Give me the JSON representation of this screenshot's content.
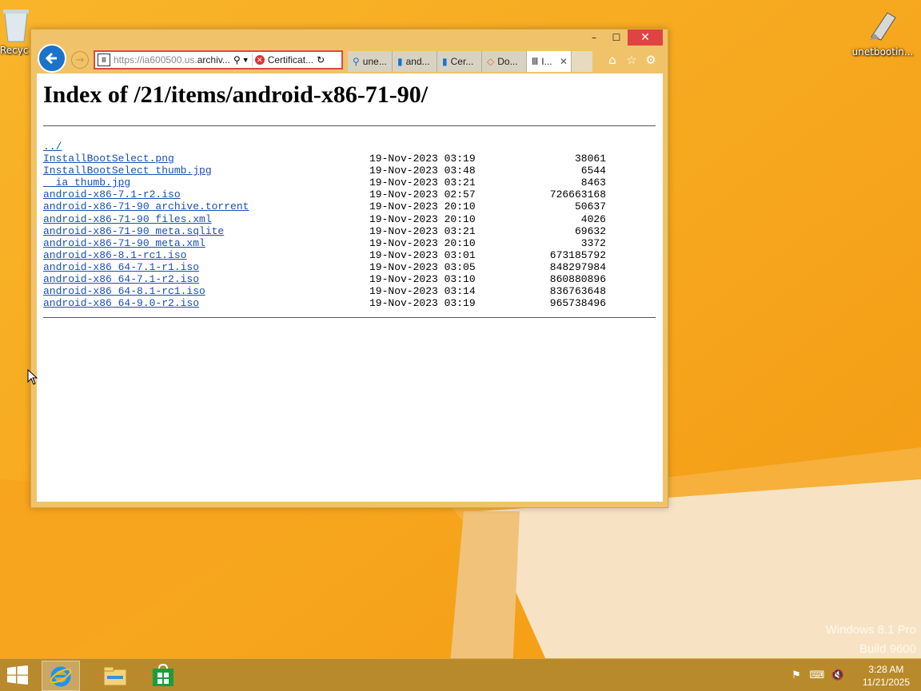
{
  "desktop": {
    "icons": [
      {
        "label": "Recycle Bin",
        "visible_label": "Recyc"
      },
      {
        "label": "unetbootin..."
      }
    ],
    "watermark": {
      "line1": "Windows 8.1 Pro",
      "line2": "Build 9600"
    }
  },
  "browser": {
    "address": {
      "url_prefix": "https://ia600500.us.",
      "url_host": "archiv...",
      "cert_error": "Certificat..."
    },
    "tabs": [
      {
        "label": "une...",
        "icon": "search-icon",
        "active": false
      },
      {
        "label": "and...",
        "icon": "page-icon",
        "active": false
      },
      {
        "label": "Cer...",
        "icon": "page-icon",
        "active": false
      },
      {
        "label": "Do...",
        "icon": "diamond-icon",
        "active": false
      },
      {
        "label": "I...",
        "icon": "archive-icon",
        "active": true
      }
    ],
    "title_buttons": {
      "minimize": "–",
      "maximize": "☐",
      "close": "✕"
    }
  },
  "page": {
    "title": "Index of /21/items/android-x86-71-90/",
    "parent_link": "../",
    "files": [
      {
        "name": "InstallBootSelect.png",
        "date": "19-Nov-2023 03:19",
        "size": "38061"
      },
      {
        "name": "InstallBootSelect_thumb.jpg",
        "date": "19-Nov-2023 03:48",
        "size": "6544"
      },
      {
        "name": "__ia_thumb.jpg",
        "date": "19-Nov-2023 03:21",
        "size": "8463"
      },
      {
        "name": "android-x86-7.1-r2.iso",
        "date": "19-Nov-2023 02:57",
        "size": "726663168"
      },
      {
        "name": "android-x86-71-90_archive.torrent",
        "date": "19-Nov-2023 20:10",
        "size": "50637"
      },
      {
        "name": "android-x86-71-90_files.xml",
        "date": "19-Nov-2023 20:10",
        "size": "4026"
      },
      {
        "name": "android-x86-71-90_meta.sqlite",
        "date": "19-Nov-2023 03:21",
        "size": "69632"
      },
      {
        "name": "android-x86-71-90_meta.xml",
        "date": "19-Nov-2023 20:10",
        "size": "3372"
      },
      {
        "name": "android-x86-8.1-rc1.iso",
        "date": "19-Nov-2023 03:01",
        "size": "673185792"
      },
      {
        "name": "android-x86_64-7.1-r1.iso",
        "date": "19-Nov-2023 03:05",
        "size": "848297984"
      },
      {
        "name": "android-x86_64-7.1-r2.iso",
        "date": "19-Nov-2023 03:10",
        "size": "860880896"
      },
      {
        "name": "android-x86_64-8.1-rc1.iso",
        "date": "19-Nov-2023 03:14",
        "size": "836763648"
      },
      {
        "name": "android-x86_64-9.0-r2.iso",
        "date": "19-Nov-2023 03:19",
        "size": "965738496"
      }
    ]
  },
  "taskbar": {
    "clock_time": "3:28 AM",
    "clock_date": "11/21/2025"
  },
  "colors": {
    "accent": "#1a73c9",
    "link": "#1a4fb3",
    "close_red": "#e04343",
    "desktop": "#f7a418"
  }
}
